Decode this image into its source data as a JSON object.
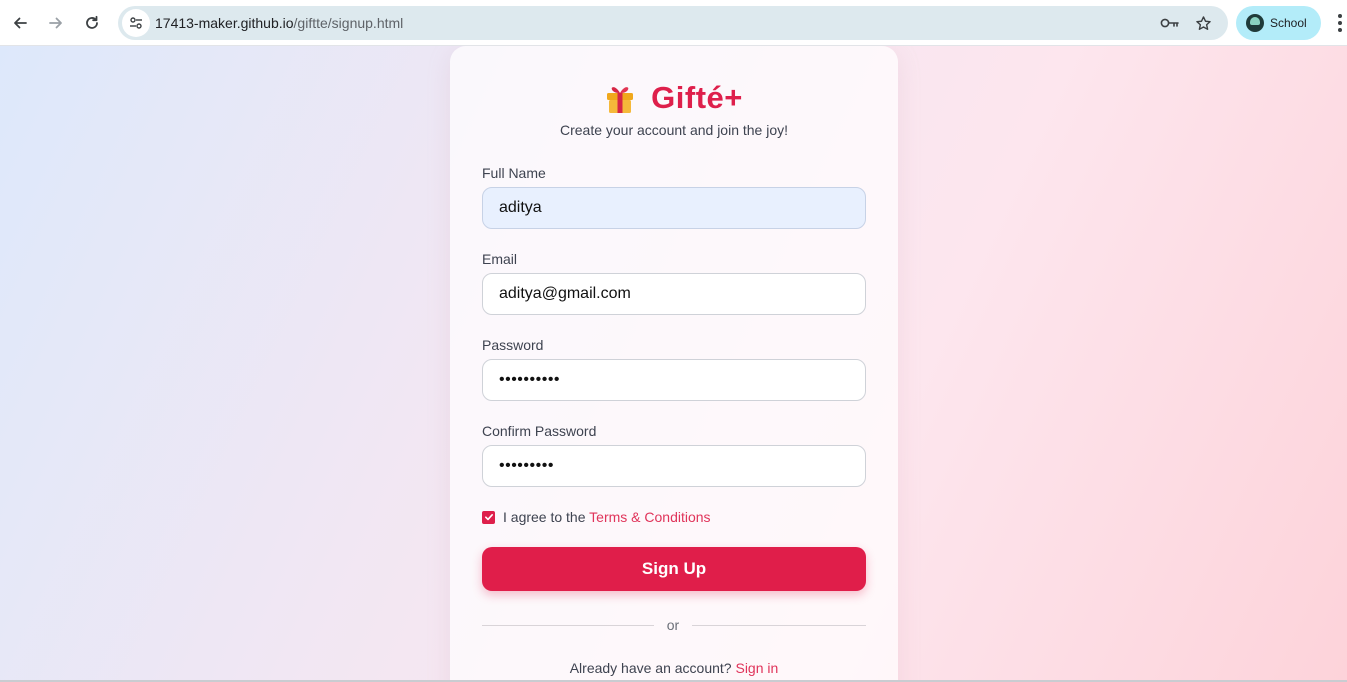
{
  "browser": {
    "url_host": "17413-maker.github.io",
    "url_path": "/giftte/signup.html",
    "profile_label": "School",
    "icons": {
      "back": "arrow-left-icon",
      "forward": "arrow-right-icon",
      "reload": "reload-icon",
      "site_info": "tune-icon",
      "password": "key-icon",
      "bookmark": "star-icon",
      "menu": "more-vert-icon"
    }
  },
  "page": {
    "brand": {
      "icon": "gift-icon",
      "title": "Gifté+",
      "tagline": "Create your account and join the joy!"
    },
    "form": {
      "full_name": {
        "label": "Full Name",
        "value": "aditya"
      },
      "email": {
        "label": "Email",
        "value": "aditya@gmail.com"
      },
      "password": {
        "label": "Password",
        "value": "••••••••••"
      },
      "confirm_password": {
        "label": "Confirm Password",
        "value": "•••••••••"
      },
      "agree": {
        "checked": true,
        "text": "I agree to the",
        "link": "Terms & Conditions"
      },
      "submit_label": "Sign Up"
    },
    "divider_text": "or",
    "signin": {
      "text": "Already have an account?",
      "link": "Sign in"
    },
    "colors": {
      "accent": "#e01e4a",
      "link": "#e0345a"
    }
  }
}
